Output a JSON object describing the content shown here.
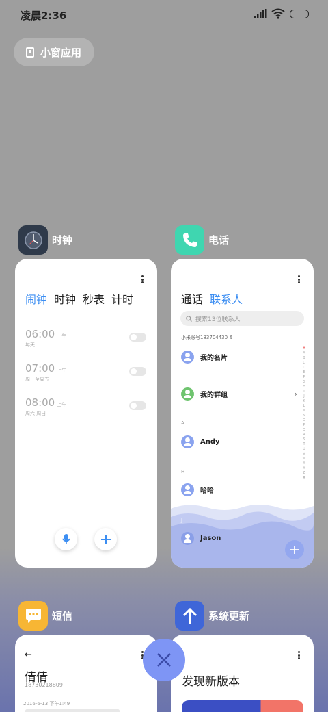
{
  "status_bar": {
    "time": "凌晨2:36"
  },
  "small_window_button": {
    "label": "小窗应用"
  },
  "cards": {
    "clock": {
      "app_name": "时钟",
      "tabs": [
        "闹钟",
        "时钟",
        "秒表",
        "计时"
      ],
      "alarms": [
        {
          "time": "06:00",
          "ampm": "上午",
          "days": "每天",
          "enabled": false
        },
        {
          "time": "07:00",
          "ampm": "上午",
          "days": "周一至周五",
          "enabled": false
        },
        {
          "time": "08:00",
          "ampm": "上午",
          "days": "周六 周日",
          "enabled": false
        }
      ]
    },
    "phone": {
      "app_name": "电话",
      "tabs": [
        "通话",
        "联系人"
      ],
      "search_placeholder": "搜索13位联系人",
      "account": "小米账号183704430",
      "my_card": "我的名片",
      "my_groups": "我的群组",
      "sections": [
        {
          "letter": "A",
          "name": "Andy"
        },
        {
          "letter": "H",
          "name": "哈哈"
        },
        {
          "letter": "J",
          "name": "Jason"
        }
      ],
      "alphabet": "♥ABCDEFGHIJKLMNOPQRSTUVWXYZ#"
    },
    "messages": {
      "app_name": "短信",
      "contact": "倩倩",
      "number": "18730218809",
      "date": "2016-6-13 下午1:49"
    },
    "update": {
      "app_name": "系统更新",
      "headline": "发现新版本"
    }
  },
  "colors": {
    "accent": "#3c8ef2",
    "close_button": "#7e95f5",
    "clock_icon_bg": "#2f3a4a",
    "phone_icon_bg": "#3fd6b0",
    "msg_icon_bg": "#f7b634",
    "update_icon_bg": "#3f66d8"
  }
}
